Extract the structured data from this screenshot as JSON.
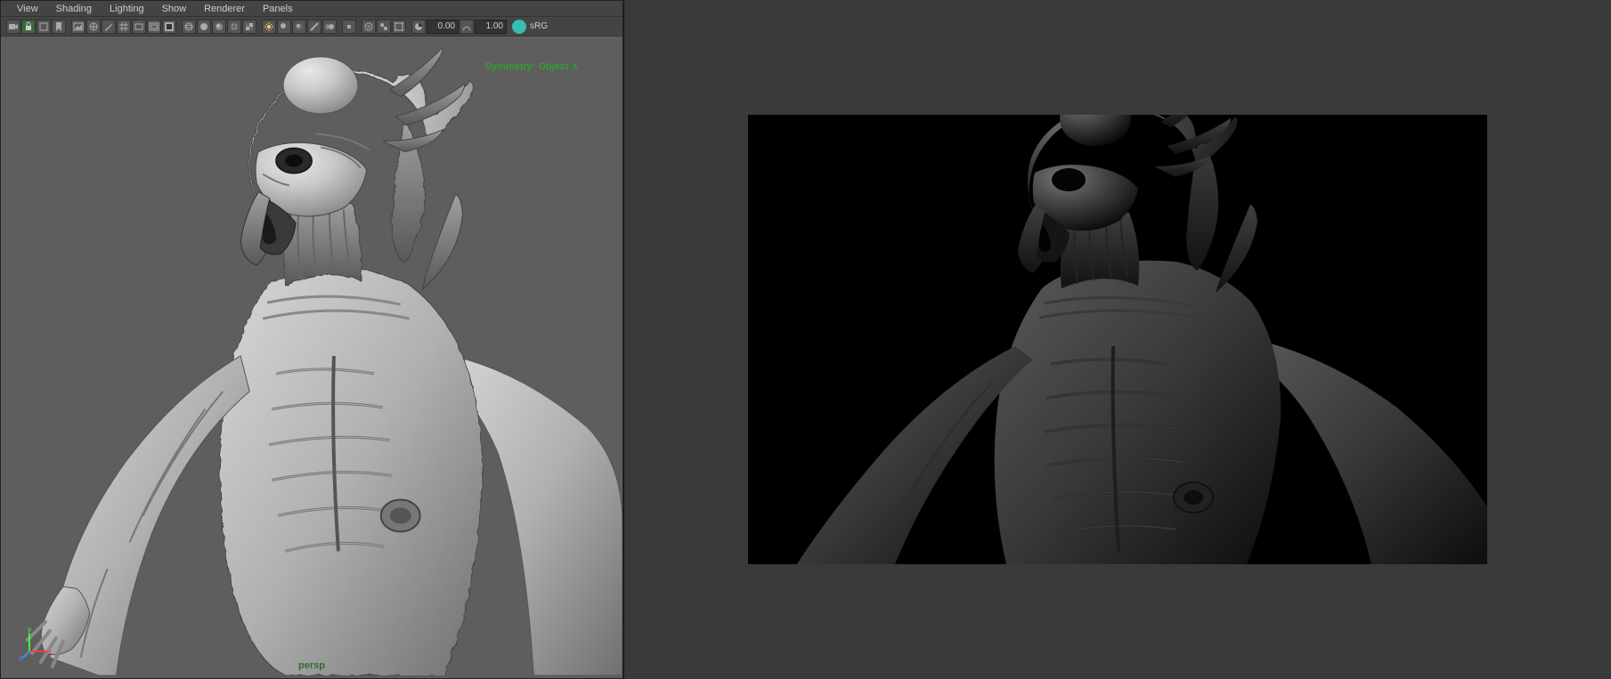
{
  "menu": {
    "items": [
      "View",
      "Shading",
      "Lighting",
      "Show",
      "Renderer",
      "Panels"
    ]
  },
  "toolbar": {
    "val1": "0.00",
    "val2": "1.00",
    "colorSpace": "sRG"
  },
  "viewport": {
    "symmetry": "Symmetry: Object X",
    "camera": "persp"
  }
}
